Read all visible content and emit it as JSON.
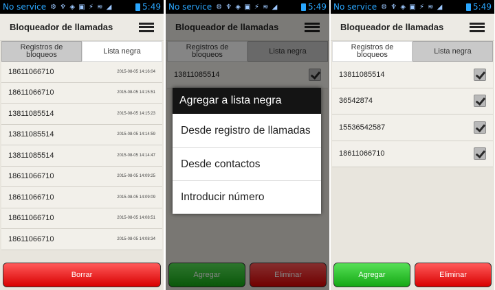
{
  "status": {
    "carrier": "No service",
    "icons": "⚙ ♆ ◈  ▣ ⚡ ≋ ◢",
    "time": "5:49"
  },
  "app": {
    "title": "Bloqueador de llamadas",
    "menu_icon": "menu-icon"
  },
  "tabs": {
    "registros": "Registros de bloqueos",
    "lista": "Lista negra"
  },
  "screen1": {
    "rows": [
      {
        "number": "18611066710",
        "time": "2015-08-05 14:16:04"
      },
      {
        "number": "18611066710",
        "time": "2015-08-05 14:15:51"
      },
      {
        "number": "13811085514",
        "time": "2015-08-05 14:15:23"
      },
      {
        "number": "13811085514",
        "time": "2015-08-05 14:14:59"
      },
      {
        "number": "13811085514",
        "time": "2015-08-05 14:14:47"
      },
      {
        "number": "18611066710",
        "time": "2015-08-05 14:09:25"
      },
      {
        "number": "18611066710",
        "time": "2015-08-05 14:09:09"
      },
      {
        "number": "18611066710",
        "time": "2015-08-05 14:08:51"
      },
      {
        "number": "18611066710",
        "time": "2015-08-05 14:08:34"
      }
    ],
    "delete_button": "Borrar"
  },
  "screen2": {
    "first_row": "13811085514",
    "dialog": {
      "title": "Agregar a lista negra",
      "options": [
        "Desde registro de llamadas",
        "Desde contactos",
        "Introducir número"
      ]
    },
    "add_button": "Agregar",
    "remove_button": "Eliminar"
  },
  "screen3": {
    "rows": [
      {
        "number": "13811085514",
        "checked": true
      },
      {
        "number": "36542874",
        "checked": true
      },
      {
        "number": "15536542587",
        "checked": true
      },
      {
        "number": "18611066710",
        "checked": true
      }
    ],
    "add_button": "Agregar",
    "remove_button": "Eliminar"
  },
  "colors": {
    "accent_blue": "#2aa7ff",
    "delete_red": "#e01010",
    "add_green": "#1fb51f"
  }
}
